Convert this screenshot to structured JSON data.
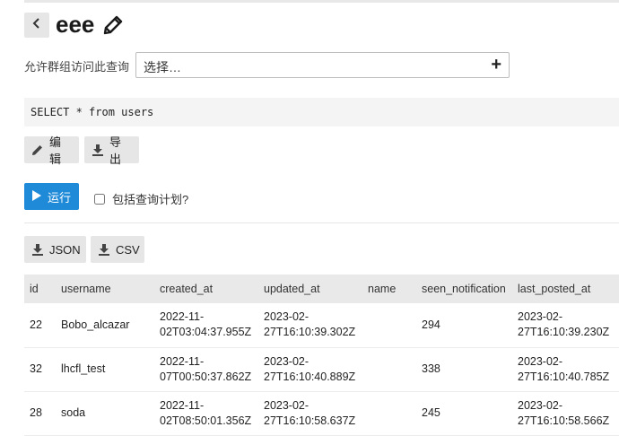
{
  "header": {
    "title": "eee"
  },
  "permissions": {
    "label": "允许群组访问此查询",
    "placeholder": "选择…"
  },
  "query": {
    "sql": "SELECT * from users"
  },
  "toolbar": {
    "edit_label": "编辑",
    "export_label": "导出"
  },
  "run": {
    "run_label": "运行",
    "explain_label": "包括查询计划?",
    "explain_checked": false
  },
  "downloads": {
    "json_label": "JSON",
    "csv_label": "CSV"
  },
  "results": {
    "columns": [
      "id",
      "username",
      "created_at",
      "updated_at",
      "name",
      "seen_notification",
      "last_posted_at"
    ],
    "rows": [
      [
        "22",
        "Bobo_alcazar",
        "2022-11-02T03:04:37.955Z",
        "2023-02-27T16:10:39.302Z",
        "",
        "294",
        "2023-02-27T16:10:39.230Z"
      ],
      [
        "32",
        "lhcfl_test",
        "2022-11-07T00:50:37.862Z",
        "2023-02-27T16:10:40.889Z",
        "",
        "338",
        "2023-02-27T16:10:40.785Z"
      ],
      [
        "28",
        "soda",
        "2022-11-02T08:50:01.356Z",
        "2023-02-27T16:10:58.637Z",
        "",
        "245",
        "2023-02-27T16:10:58.566Z"
      ]
    ]
  },
  "icons": {
    "back": "chevron-left-icon",
    "edit_title": "pencil-icon",
    "add": "plus-icon",
    "edit": "pencil-icon",
    "export": "download-icon",
    "run": "play-icon",
    "download": "download-icon"
  },
  "colors": {
    "primary": "#1f8ad8",
    "button_bg": "#e6e6e6",
    "table_header_bg": "#e9e9e9"
  }
}
